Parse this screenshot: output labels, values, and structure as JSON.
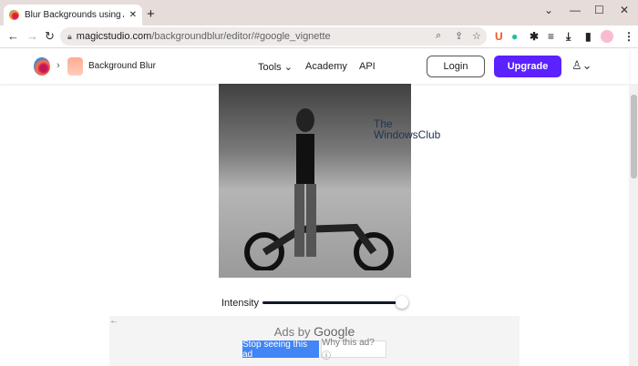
{
  "browser": {
    "tab_title": "Blur Backgrounds using AI | Backgr",
    "url_domain": "magicstudio.com",
    "url_path": "/backgroundblur/editor/#google_vignette"
  },
  "site": {
    "app_name": "Background Blur",
    "nav": [
      "Tools",
      "Academy",
      "API"
    ],
    "login": "Login",
    "upgrade": "Upgrade"
  },
  "editor": {
    "intensity_label": "Intensity",
    "intensity_value": 100,
    "watermark": [
      "The",
      "WindowsClub"
    ]
  },
  "ad": {
    "ads_by": "Ads by",
    "google": "Google",
    "stop": "Stop seeing this ad",
    "why": "Why this ad? ⓘ"
  }
}
